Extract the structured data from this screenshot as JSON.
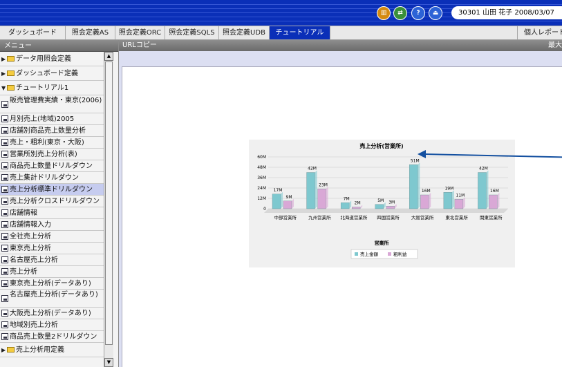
{
  "header": {
    "icons": [
      "chart-icon",
      "switch-icon",
      "help-icon",
      "logout-icon"
    ],
    "user_info": "30301 山田 花子 2008/03/07"
  },
  "tabs": [
    {
      "label": "ダッシュボード",
      "active": false
    },
    {
      "label": "照会定義AS",
      "active": false
    },
    {
      "label": "照会定義ORC",
      "active": false
    },
    {
      "label": "照会定義SQLS",
      "active": false
    },
    {
      "label": "照会定義UDB",
      "active": false
    },
    {
      "label": "チュートリアル",
      "active": true
    },
    {
      "label": "個人レポート",
      "active": false
    }
  ],
  "sidebar": {
    "header": "メニュー",
    "items": [
      {
        "type": "folder",
        "expanded": false,
        "label": "データ用照会定義"
      },
      {
        "type": "folder",
        "expanded": false,
        "label": "ダッシュボード定義"
      },
      {
        "type": "folder",
        "expanded": true,
        "label": "チュートリアル1"
      },
      {
        "type": "report",
        "label": "販売管理費実績・東京(2006)"
      },
      {
        "type": "report",
        "label": "月別売上(地域)2005"
      },
      {
        "type": "report",
        "label": "店舗別商品売上数量分析"
      },
      {
        "type": "report",
        "label": "売上・粗利(東京・大阪)"
      },
      {
        "type": "report",
        "label": "営業所別売上分析(表)"
      },
      {
        "type": "report",
        "label": "商品売上数量ドリルダウン"
      },
      {
        "type": "report",
        "label": "売上集計ドリルダウン"
      },
      {
        "type": "report",
        "label": "売上分析標準ドリルダウン",
        "selected": true
      },
      {
        "type": "report",
        "label": "売上分析クロスドリルダウン"
      },
      {
        "type": "report",
        "label": "店舗情報"
      },
      {
        "type": "report",
        "label": "店舗情報入力"
      },
      {
        "type": "report",
        "label": "全社売上分析"
      },
      {
        "type": "report",
        "label": "東京売上分析"
      },
      {
        "type": "report",
        "label": "名古屋売上分析"
      },
      {
        "type": "report",
        "label": "売上分析"
      },
      {
        "type": "report",
        "label": "東京売上分析(データあり)"
      },
      {
        "type": "report",
        "label": "名古屋売上分析(データあり)"
      },
      {
        "type": "report",
        "label": "大阪売上分析(データあり)"
      },
      {
        "type": "report",
        "label": "地域別売上分析"
      },
      {
        "type": "report",
        "label": "商品売上数量2ドリルダウン"
      },
      {
        "type": "folder",
        "expanded": false,
        "label": "売上分析用定義"
      }
    ]
  },
  "main": {
    "header": "URLコピー",
    "maximize_label": "最大化"
  },
  "chart_data": {
    "type": "bar",
    "title": "売上分析(営業所)",
    "xlabel": "営業所",
    "ylabel": "",
    "categories": [
      "中部営業所",
      "九州営業所",
      "北海道営業所",
      "四国営業所",
      "大阪営業所",
      "東北営業所",
      "関東営業所"
    ],
    "series": [
      {
        "name": "売上金額",
        "values": [
          17,
          42,
          7,
          5,
          51,
          19,
          42
        ],
        "labels": [
          "17M",
          "42M",
          "7M",
          "5M",
          "51M",
          "19M",
          "42M"
        ],
        "color": "#7ec8cf"
      },
      {
        "name": "粗利益",
        "values": [
          9,
          23,
          2,
          3,
          16,
          11,
          16
        ],
        "labels": [
          "9M",
          "23M",
          "2M",
          "3M",
          "16M",
          "11M",
          "16M"
        ],
        "color": "#d9a8d6"
      }
    ],
    "ylim": [
      0,
      60
    ],
    "yticks": [
      "0",
      "12M",
      "24M",
      "36M",
      "48M",
      "60M"
    ],
    "grid": true,
    "legend": "bottom",
    "annotation": "arrow pointing to highest bar (大阪営業所)"
  }
}
